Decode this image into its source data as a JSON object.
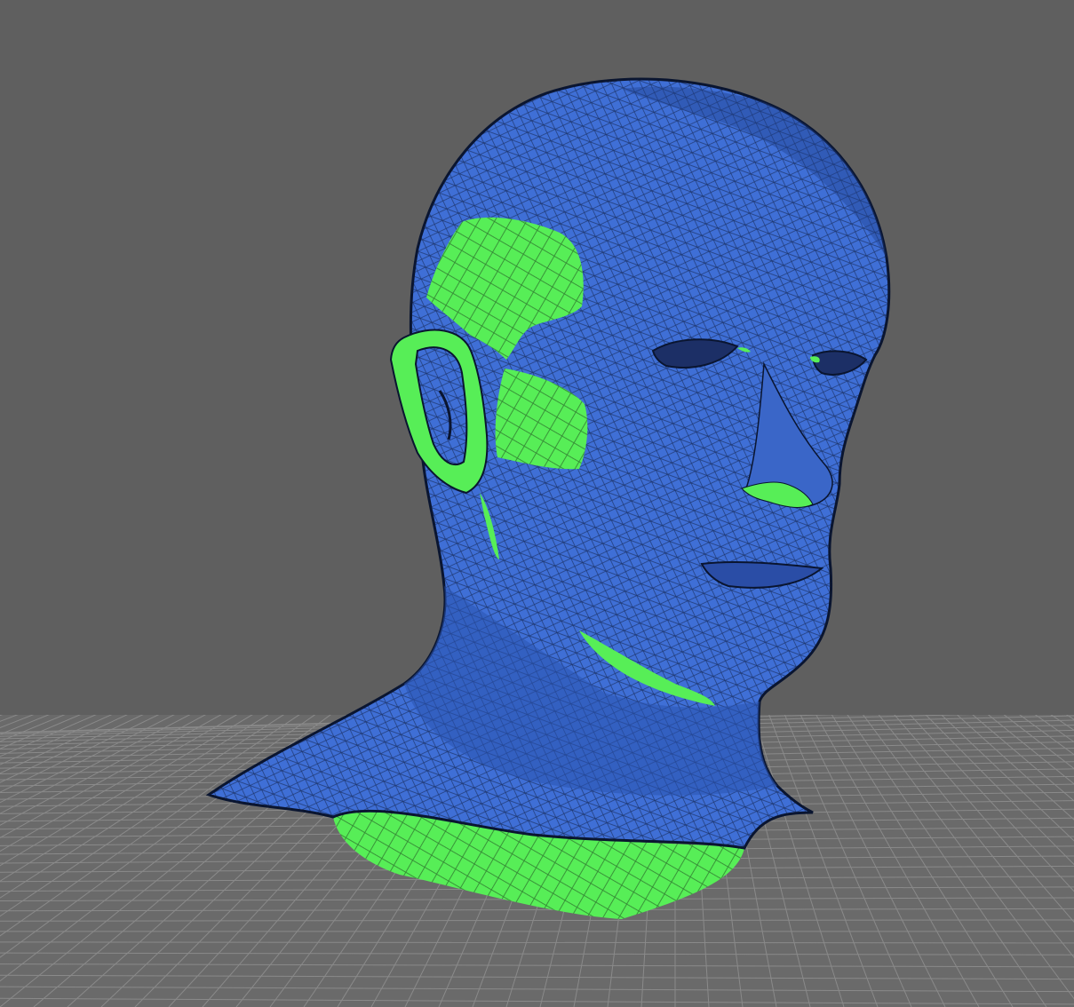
{
  "viewport": {
    "background_color": "#5f5f5f",
    "grid_line_color": "#8a8a8a",
    "grid_floor_color": "#6a6a6a"
  },
  "mesh": {
    "name_icon": "head-mesh-model",
    "surface_color": "#3f6fd6",
    "wire_color": "#0d1a3a",
    "highlight_color": "#57ee57"
  }
}
